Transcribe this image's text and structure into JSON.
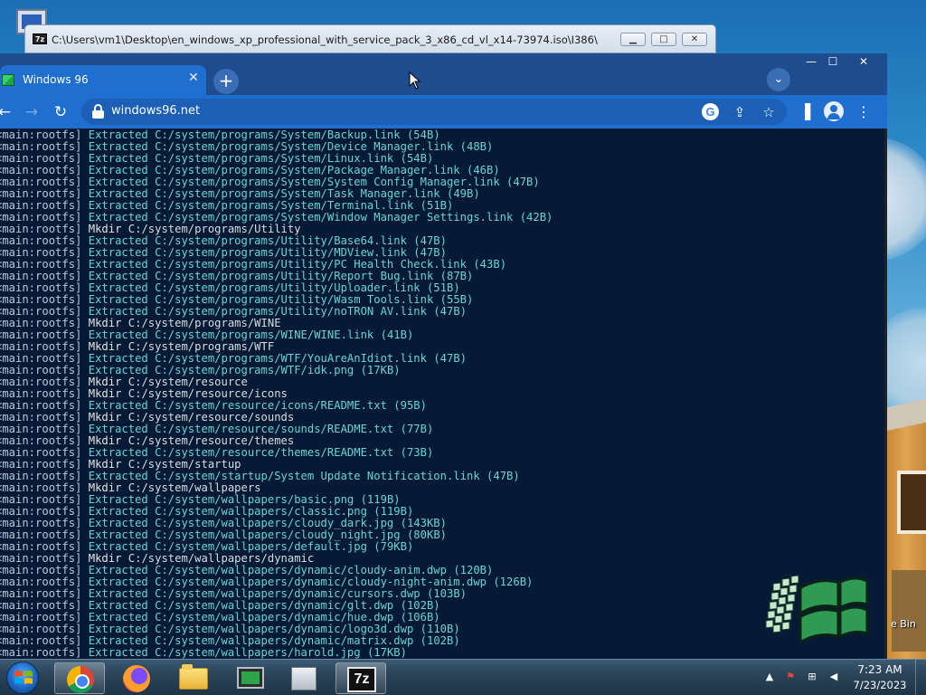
{
  "zip_window": {
    "title": "C:\\Users\\vm1\\Desktop\\en_windows_xp_professional_with_service_pack_3_x86_cd_vl_x14-73974.iso\\I386\\",
    "icon_text": "7z",
    "min_icon": "minimize-icon",
    "max_icon": "maximize-icon",
    "close_icon": "close-icon"
  },
  "browser": {
    "tab": {
      "label": "Windows 96",
      "favicon": "windows96-icon",
      "close_glyph": "✕"
    },
    "new_tab_glyph": "+",
    "tab_search_glyph": "⌄",
    "window_controls": {
      "min": "—",
      "max": "☐",
      "close": "✕"
    },
    "nav": {
      "back": "←",
      "forward": "→",
      "reload": "↻"
    },
    "url": "windows96.net",
    "omnibox_icons": [
      "google-icon",
      "share-icon",
      "bookmark-star-icon"
    ],
    "toolbar_icons": [
      "side-panel-icon",
      "profile-icon",
      "menu-icon"
    ],
    "glyphs": {
      "share": "⇪",
      "star": "☆",
      "side_panel": "▐",
      "menu": "⋮"
    }
  },
  "terminal": {
    "lines": [
      {
        "tag": "<main:rootfs]",
        "verb": "Extracted",
        "path": "C:/system/programs/System/Backup.link",
        "size": "(54B)"
      },
      {
        "tag": "<main:rootfs]",
        "verb": "Extracted",
        "path": "C:/system/programs/System/Device Manager.link",
        "size": "(48B)"
      },
      {
        "tag": "<main:rootfs]",
        "verb": "Extracted",
        "path": "C:/system/programs/System/Linux.link",
        "size": "(54B)"
      },
      {
        "tag": "<main:rootfs]",
        "verb": "Extracted",
        "path": "C:/system/programs/System/Package Manager.link",
        "size": "(46B)"
      },
      {
        "tag": "<main:rootfs]",
        "verb": "Extracted",
        "path": "C:/system/programs/System/System Config Manager.link",
        "size": "(47B)"
      },
      {
        "tag": "<main:rootfs]",
        "verb": "Extracted",
        "path": "C:/system/programs/System/Task Manager.link",
        "size": "(49B)"
      },
      {
        "tag": "<main:rootfs]",
        "verb": "Extracted",
        "path": "C:/system/programs/System/Terminal.link",
        "size": "(51B)"
      },
      {
        "tag": "<main:rootfs]",
        "verb": "Extracted",
        "path": "C:/system/programs/System/Window Manager Settings.link",
        "size": "(42B)"
      },
      {
        "tag": "<main:rootfs]",
        "verb": "Mkdir",
        "path": "C:/system/programs/Utility",
        "size": ""
      },
      {
        "tag": "<main:rootfs]",
        "verb": "Extracted",
        "path": "C:/system/programs/Utility/Base64.link",
        "size": "(47B)"
      },
      {
        "tag": "<main:rootfs]",
        "verb": "Extracted",
        "path": "C:/system/programs/Utility/MDView.link",
        "size": "(47B)"
      },
      {
        "tag": "<main:rootfs]",
        "verb": "Extracted",
        "path": "C:/system/programs/Utility/PC Health Check.link",
        "size": "(43B)"
      },
      {
        "tag": "<main:rootfs]",
        "verb": "Extracted",
        "path": "C:/system/programs/Utility/Report Bug.link",
        "size": "(87B)"
      },
      {
        "tag": "<main:rootfs]",
        "verb": "Extracted",
        "path": "C:/system/programs/Utility/Uploader.link",
        "size": "(51B)"
      },
      {
        "tag": "<main:rootfs]",
        "verb": "Extracted",
        "path": "C:/system/programs/Utility/Wasm Tools.link",
        "size": "(55B)"
      },
      {
        "tag": "<main:rootfs]",
        "verb": "Extracted",
        "path": "C:/system/programs/Utility/noTRON AV.link",
        "size": "(47B)"
      },
      {
        "tag": "<main:rootfs]",
        "verb": "Mkdir",
        "path": "C:/system/programs/WINE",
        "size": ""
      },
      {
        "tag": "<main:rootfs]",
        "verb": "Extracted",
        "path": "C:/system/programs/WINE/WINE.link",
        "size": "(41B)"
      },
      {
        "tag": "<main:rootfs]",
        "verb": "Mkdir",
        "path": "C:/system/programs/WTF",
        "size": ""
      },
      {
        "tag": "<main:rootfs]",
        "verb": "Extracted",
        "path": "C:/system/programs/WTF/YouAreAnIdiot.link",
        "size": "(47B)"
      },
      {
        "tag": "<main:rootfs]",
        "verb": "Extracted",
        "path": "C:/system/programs/WTF/idk.png",
        "size": "(17KB)"
      },
      {
        "tag": "<main:rootfs]",
        "verb": "Mkdir",
        "path": "C:/system/resource",
        "size": ""
      },
      {
        "tag": "<main:rootfs]",
        "verb": "Mkdir",
        "path": "C:/system/resource/icons",
        "size": ""
      },
      {
        "tag": "<main:rootfs]",
        "verb": "Extracted",
        "path": "C:/system/resource/icons/README.txt",
        "size": "(95B)"
      },
      {
        "tag": "<main:rootfs]",
        "verb": "Mkdir",
        "path": "C:/system/resource/sounds",
        "size": ""
      },
      {
        "tag": "<main:rootfs]",
        "verb": "Extracted",
        "path": "C:/system/resource/sounds/README.txt",
        "size": "(77B)"
      },
      {
        "tag": "<main:rootfs]",
        "verb": "Mkdir",
        "path": "C:/system/resource/themes",
        "size": ""
      },
      {
        "tag": "<main:rootfs]",
        "verb": "Extracted",
        "path": "C:/system/resource/themes/README.txt",
        "size": "(73B)"
      },
      {
        "tag": "<main:rootfs]",
        "verb": "Mkdir",
        "path": "C:/system/startup",
        "size": ""
      },
      {
        "tag": "<main:rootfs]",
        "verb": "Extracted",
        "path": "C:/system/startup/System Update Notification.link",
        "size": "(47B)"
      },
      {
        "tag": "<main:rootfs]",
        "verb": "Mkdir",
        "path": "C:/system/wallpapers",
        "size": ""
      },
      {
        "tag": "<main:rootfs]",
        "verb": "Extracted",
        "path": "C:/system/wallpapers/basic.png",
        "size": "(119B)"
      },
      {
        "tag": "<main:rootfs]",
        "verb": "Extracted",
        "path": "C:/system/wallpapers/classic.png",
        "size": "(119B)"
      },
      {
        "tag": "<main:rootfs]",
        "verb": "Extracted",
        "path": "C:/system/wallpapers/cloudy_dark.jpg",
        "size": "(143KB)"
      },
      {
        "tag": "<main:rootfs]",
        "verb": "Extracted",
        "path": "C:/system/wallpapers/cloudy_night.jpg",
        "size": "(80KB)"
      },
      {
        "tag": "<main:rootfs]",
        "verb": "Extracted",
        "path": "C:/system/wallpapers/default.jpg",
        "size": "(79KB)"
      },
      {
        "tag": "<main:rootfs]",
        "verb": "Mkdir",
        "path": "C:/system/wallpapers/dynamic",
        "size": ""
      },
      {
        "tag": "<main:rootfs]",
        "verb": "Extracted",
        "path": "C:/system/wallpapers/dynamic/cloudy-anim.dwp",
        "size": "(120B)"
      },
      {
        "tag": "<main:rootfs]",
        "verb": "Extracted",
        "path": "C:/system/wallpapers/dynamic/cloudy-night-anim.dwp",
        "size": "(126B)"
      },
      {
        "tag": "<main:rootfs]",
        "verb": "Extracted",
        "path": "C:/system/wallpapers/dynamic/cursors.dwp",
        "size": "(103B)"
      },
      {
        "tag": "<main:rootfs]",
        "verb": "Extracted",
        "path": "C:/system/wallpapers/dynamic/glt.dwp",
        "size": "(102B)"
      },
      {
        "tag": "<main:rootfs]",
        "verb": "Extracted",
        "path": "C:/system/wallpapers/dynamic/hue.dwp",
        "size": "(106B)"
      },
      {
        "tag": "<main:rootfs]",
        "verb": "Extracted",
        "path": "C:/system/wallpapers/dynamic/logo3d.dwp",
        "size": "(110B)"
      },
      {
        "tag": "<main:rootfs]",
        "verb": "Extracted",
        "path": "C:/system/wallpapers/dynamic/matrix.dwp",
        "size": "(102B)"
      },
      {
        "tag": "<main:rootfs]",
        "verb": "Extracted",
        "path": "C:/system/wallpapers/harold.jpg",
        "size": "(17KB)"
      }
    ]
  },
  "desktop": {
    "recycle_bin_label": "e Bin"
  },
  "taskbar": {
    "apps": [
      {
        "name": "chrome",
        "icon": "chrome-icon"
      },
      {
        "name": "firefox",
        "icon": "firefox-icon"
      },
      {
        "name": "file-explorer",
        "icon": "folder-icon"
      },
      {
        "name": "task-manager",
        "icon": "monitor-icon"
      },
      {
        "name": "computer",
        "icon": "computer-icon"
      },
      {
        "name": "7-zip",
        "icon": "7zip-icon",
        "label": "7z"
      }
    ],
    "tray_glyphs": {
      "arrow": "▲",
      "flag": "⚑",
      "network": "⊞",
      "volume": "◀"
    },
    "time": "7:23 AM",
    "date": "7/23/2023"
  },
  "colors": {
    "terminal_bg": "#051a34",
    "terminal_cyan": "#67d4d6",
    "chrome_blue": "#1e6fd0"
  }
}
